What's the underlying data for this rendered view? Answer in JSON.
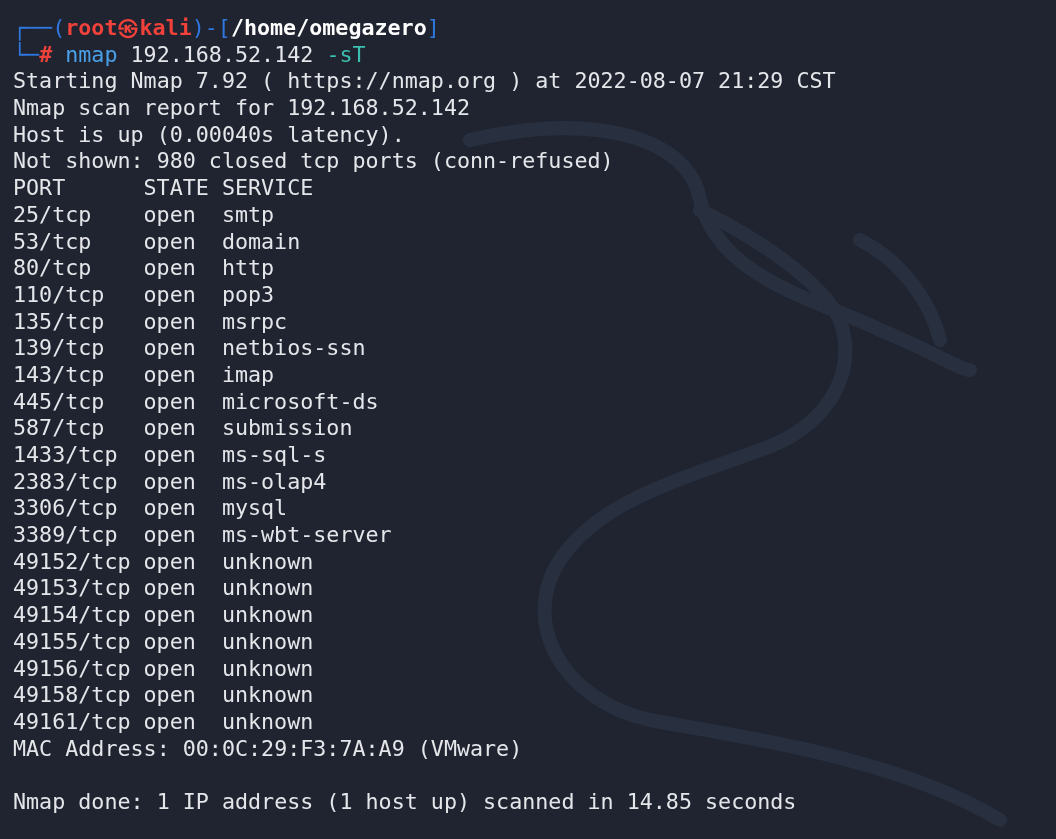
{
  "prompt": {
    "corner_top": "┌──(",
    "user": "root",
    "separator": "㉿",
    "host": "kali",
    "bracket_mid": ")-[",
    "path": "/home/omegazero",
    "bracket_end": "]",
    "corner_bottom": "└─",
    "symbol": "#",
    "command": "nmap",
    "argument": "192.168.52.142",
    "option": "-sT"
  },
  "output_before": [
    "Starting Nmap 7.92 ( https://nmap.org ) at 2022-08-07 21:29 CST",
    "Nmap scan report for 192.168.52.142",
    "Host is up (0.00040s latency).",
    "Not shown: 980 closed tcp ports (conn-refused)"
  ],
  "table": {
    "columns": [
      "PORT",
      "STATE",
      "SERVICE"
    ],
    "rows": [
      [
        "25/tcp",
        "open",
        "smtp"
      ],
      [
        "53/tcp",
        "open",
        "domain"
      ],
      [
        "80/tcp",
        "open",
        "http"
      ],
      [
        "110/tcp",
        "open",
        "pop3"
      ],
      [
        "135/tcp",
        "open",
        "msrpc"
      ],
      [
        "139/tcp",
        "open",
        "netbios-ssn"
      ],
      [
        "143/tcp",
        "open",
        "imap"
      ],
      [
        "445/tcp",
        "open",
        "microsoft-ds"
      ],
      [
        "587/tcp",
        "open",
        "submission"
      ],
      [
        "1433/tcp",
        "open",
        "ms-sql-s"
      ],
      [
        "2383/tcp",
        "open",
        "ms-olap4"
      ],
      [
        "3306/tcp",
        "open",
        "mysql"
      ],
      [
        "3389/tcp",
        "open",
        "ms-wbt-server"
      ],
      [
        "49152/tcp",
        "open",
        "unknown"
      ],
      [
        "49153/tcp",
        "open",
        "unknown"
      ],
      [
        "49154/tcp",
        "open",
        "unknown"
      ],
      [
        "49155/tcp",
        "open",
        "unknown"
      ],
      [
        "49156/tcp",
        "open",
        "unknown"
      ],
      [
        "49158/tcp",
        "open",
        "unknown"
      ],
      [
        "49161/tcp",
        "open",
        "unknown"
      ]
    ]
  },
  "output_after": [
    "MAC Address: 00:0C:29:F3:7A:A9 (VMware)"
  ],
  "summary": "Nmap done: 1 IP address (1 host up) scanned in 14.85 seconds"
}
